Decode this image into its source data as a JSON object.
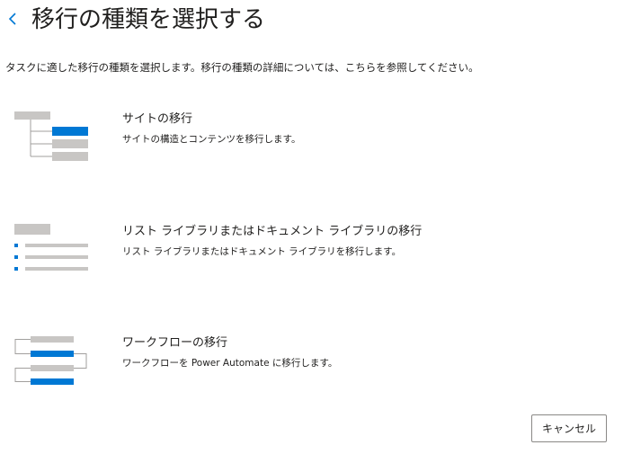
{
  "page": {
    "title": "移行の種類を選択する",
    "description": "タスクに適した移行の種類を選択します。移行の種類の詳細については、こちらを参照してください。"
  },
  "options": [
    {
      "title": "サイトの移行",
      "description": "サイトの構造とコンテンツを移行します。",
      "icon": "site-structure-icon"
    },
    {
      "title": "リスト ライブラリまたはドキュメント ライブラリの移行",
      "description": "リスト ライブラリまたはドキュメント ライブラリを移行します。",
      "icon": "list-library-icon"
    },
    {
      "title": "ワークフローの移行",
      "description": "ワークフローを Power Automate に移行します。",
      "icon": "workflow-icon"
    }
  ],
  "footer": {
    "cancel_label": "キャンセル"
  },
  "colors": {
    "accent": "#0078d4",
    "placeholder_gray": "#c8c6c4",
    "connector": "#a19f9d",
    "text": "#201f1e"
  }
}
